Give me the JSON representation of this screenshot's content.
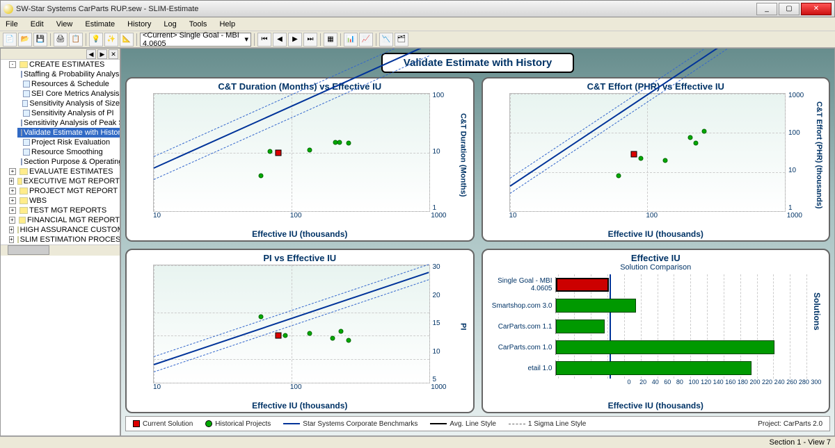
{
  "window": {
    "title": "SW-Star Systems CarParts RUP.sew - SLIM-Estimate",
    "min": "_",
    "max": "▢",
    "close": "✕"
  },
  "menu": [
    "File",
    "Edit",
    "View",
    "Estimate",
    "History",
    "Log",
    "Tools",
    "Help"
  ],
  "combo": "<Current> Single Goal - MBI 4.0605",
  "tree": {
    "root": "CREATE ESTIMATES",
    "children": [
      "Staffing & Probability Analysis",
      "Resources & Schedule",
      "SEI Core Metrics Analysis",
      "Sensitivity Analysis of Size",
      "Sensitivity Analysis of PI",
      "Sensitivity Analysis of Peak Staff",
      "Validate Estimate with History",
      "Project Risk Evaluation",
      "Resource Smoothing",
      "Section Purpose & Operating Pr"
    ],
    "folders": [
      "EVALUATE ESTIMATES",
      "EXECUTIVE MGT REPORT",
      "PROJECT MGT REPORT",
      "WBS",
      "TEST MGT REPORTS",
      "FINANCIAL MGT REPORT",
      "HIGH ASSURANCE CUSTOMER P",
      "SLIM ESTIMATION PROCESS"
    ],
    "selected": 6
  },
  "page_title": "Validate Estimate with History",
  "legend": {
    "cur": "Current Solution",
    "hist": "Historical Projects",
    "bench": "Star Systems Corporate Benchmarks",
    "avg": "Avg. Line Style",
    "sigma": "1 Sigma Line Style",
    "proj": "Project: CarParts 2.0"
  },
  "status": "Section 1 - View 7",
  "chart_data": [
    {
      "type": "scatter",
      "title": "C&T Duration (Months) vs Effective IU",
      "xlabel": "Effective IU (thousands)",
      "ylabel": "C&T Duration (Months)",
      "xscale": "log",
      "yscale": "log",
      "xlim": [
        10,
        1000
      ],
      "ylim": [
        1,
        100
      ],
      "xticks": [
        10,
        100,
        1000
      ],
      "yticks": [
        1,
        10,
        100
      ],
      "points": [
        {
          "x": 60,
          "y": 4.0,
          "kind": "hist"
        },
        {
          "x": 70,
          "y": 10.5,
          "kind": "hist"
        },
        {
          "x": 80,
          "y": 10.0,
          "kind": "cur"
        },
        {
          "x": 135,
          "y": 11.0,
          "kind": "hist"
        },
        {
          "x": 210,
          "y": 15.0,
          "kind": "hist"
        },
        {
          "x": 225,
          "y": 15.0,
          "kind": "hist"
        },
        {
          "x": 260,
          "y": 14.5,
          "kind": "hist"
        }
      ],
      "trend": {
        "slope_logy_per_decade": 0.45,
        "intercept_at_x10": 5.5
      }
    },
    {
      "type": "scatter",
      "title": "C&T Effort (PHR) vs Effective IU",
      "xlabel": "Effective IU (thousands)",
      "ylabel": "C&T Effort (PHR) (thousands)",
      "xscale": "log",
      "yscale": "log",
      "xlim": [
        10,
        1000
      ],
      "ylim": [
        1,
        1000
      ],
      "xticks": [
        10,
        100,
        1000
      ],
      "yticks": [
        1,
        10,
        100,
        1000
      ],
      "points": [
        {
          "x": 62,
          "y": 8,
          "kind": "hist"
        },
        {
          "x": 80,
          "y": 28,
          "kind": "cur"
        },
        {
          "x": 90,
          "y": 22,
          "kind": "hist"
        },
        {
          "x": 135,
          "y": 20,
          "kind": "hist"
        },
        {
          "x": 205,
          "y": 75,
          "kind": "hist"
        },
        {
          "x": 225,
          "y": 55,
          "kind": "hist"
        },
        {
          "x": 260,
          "y": 110,
          "kind": "hist"
        }
      ],
      "trend": {
        "slope_logy_per_decade": 1.0,
        "intercept_at_x10": 4.5
      }
    },
    {
      "type": "scatter",
      "title": "PI vs Effective IU",
      "xlabel": "Effective IU (thousands)",
      "ylabel": "PI",
      "xscale": "log",
      "yscale": "linear",
      "xlim": [
        10,
        1000
      ],
      "ylim": [
        5,
        30
      ],
      "xticks": [
        10,
        100,
        1000
      ],
      "yticks": [
        5,
        10,
        15,
        20,
        30
      ],
      "points": [
        {
          "x": 60,
          "y": 19,
          "kind": "hist"
        },
        {
          "x": 80,
          "y": 15,
          "kind": "cur"
        },
        {
          "x": 90,
          "y": 15,
          "kind": "hist"
        },
        {
          "x": 135,
          "y": 15.5,
          "kind": "hist"
        },
        {
          "x": 200,
          "y": 14.5,
          "kind": "hist"
        },
        {
          "x": 230,
          "y": 16,
          "kind": "hist"
        },
        {
          "x": 260,
          "y": 14,
          "kind": "hist"
        }
      ],
      "trend": {
        "slope_y_per_decade": 4.2,
        "intercept_at_x10": 9
      }
    },
    {
      "type": "bar",
      "title": "Effective IU",
      "subtitle": "Solution Comparison",
      "xlabel": "Effective IU (thousands)",
      "ylabel": "Solutions",
      "orientation": "horizontal",
      "xlim": [
        0,
        300
      ],
      "xticks": [
        0,
        20,
        40,
        60,
        80,
        100,
        120,
        140,
        160,
        180,
        200,
        220,
        240,
        260,
        280,
        300
      ],
      "avg_line_x": 80,
      "series": [
        {
          "name": "Single Goal - MBI 4.0605",
          "value": 60,
          "color": "#cc0000"
        },
        {
          "name": "Smartshop.com 3.0",
          "value": 90,
          "color": "#009900"
        },
        {
          "name": "CarParts.com 1.1",
          "value": 55,
          "color": "#009900"
        },
        {
          "name": "CarParts.com 1.0",
          "value": 245,
          "color": "#009900"
        },
        {
          "name": "etail 1.0",
          "value": 220,
          "color": "#009900"
        }
      ]
    }
  ]
}
